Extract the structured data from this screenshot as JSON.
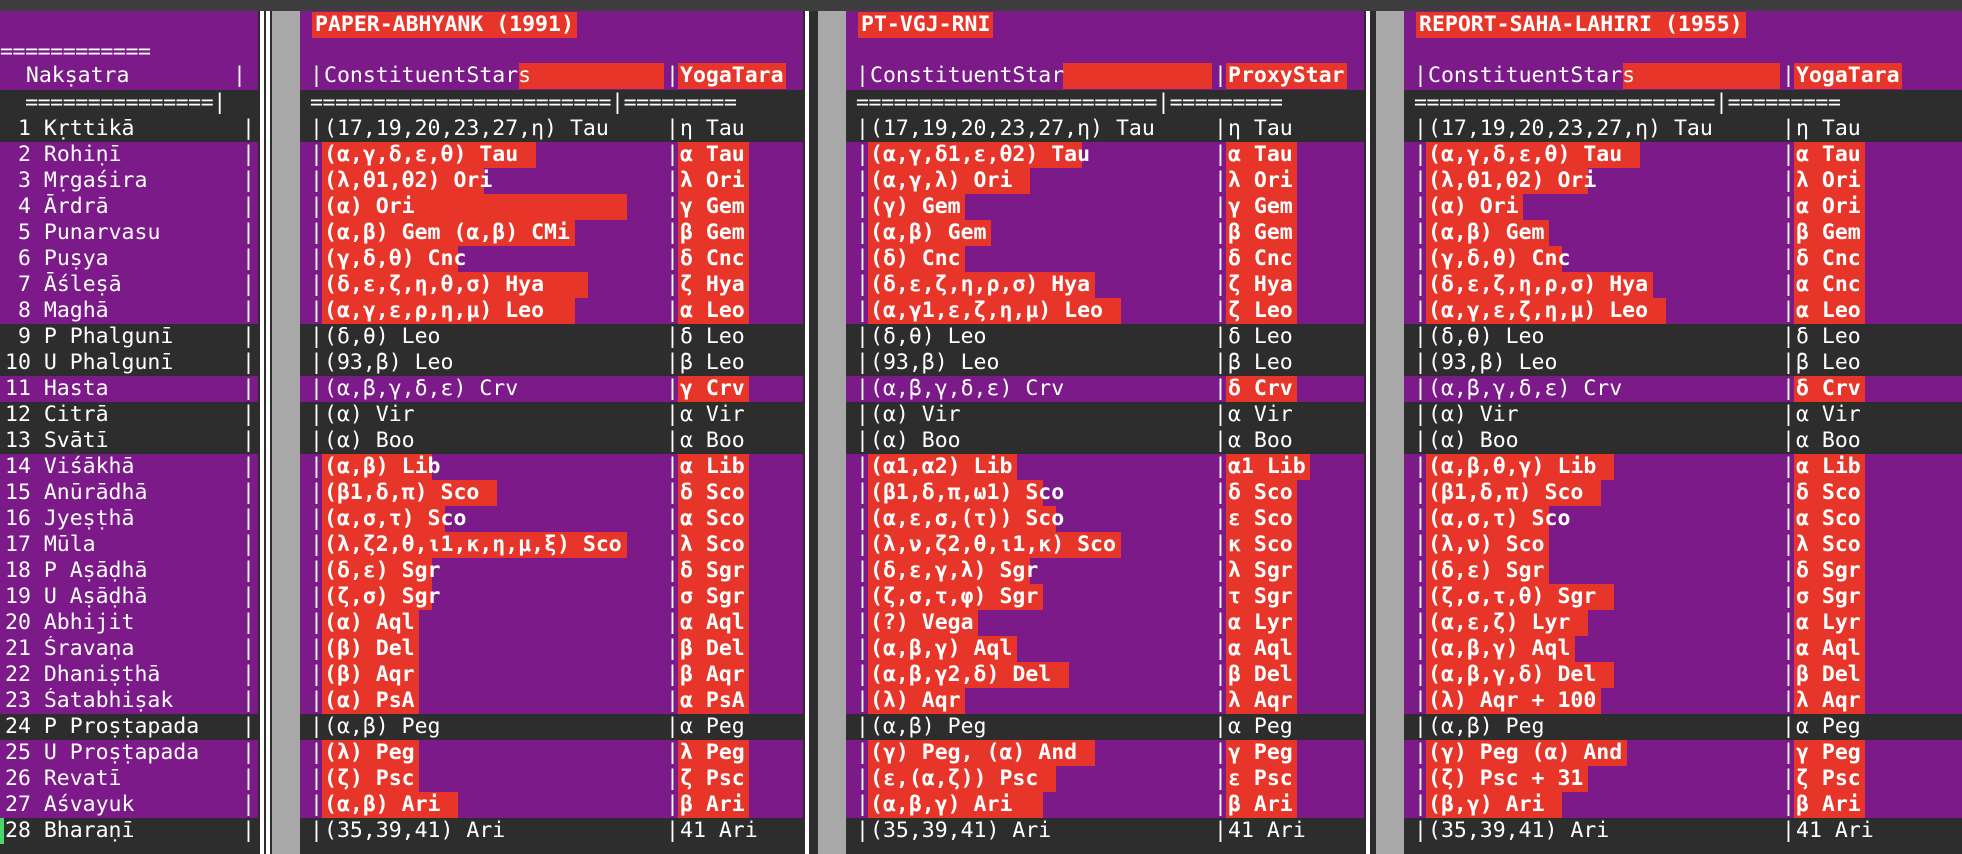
{
  "colors": {
    "purple": "#7b1a88",
    "red": "#e8352a",
    "gray": "#2d2d2d",
    "white": "#ffffff",
    "gutter": "#a8a8a8"
  },
  "index_pane": {
    "equals_top": "============",
    "header": "  Nakṣatra        |",
    "equals_header": "  ===============|",
    "rows": [
      "1 Kṛttikā",
      "2 Rohiṇī",
      "3 Mṛgaśira",
      "4 Ārdrā",
      "5 Punarvasu",
      "6 Puṣya",
      "7 Āśleṣā",
      "8 Maghā",
      "9 P Phalgunī",
      "10 U Phalgunī",
      "11 Hasta",
      "12 Citrā",
      "13 Svātī",
      "14 Viśākhā",
      "15 Anūrādhā",
      "16 Jyeṣṭhā",
      "17 Mūla",
      "18 P Aṣāḍhā",
      "19 U Aṣāḍhā",
      "20 Abhijit",
      "21 Śravaṇa",
      "22 Dhaniṣṭhā",
      "23 Śatabhiṣak",
      "24 P Proṣṭapada",
      "25 U Proṣṭapada",
      "26 Revatī",
      "27 Aśvayuk",
      "28 Bharaṇī"
    ]
  },
  "panes": [
    {
      "title": "PAPER-ABHYANK (1991)",
      "col1_header": "ConstituentStars",
      "col2_header": "YogaTara",
      "equals_header": "========================|=========",
      "rows": [
        [
          "(17,19,20,23,27,η) Tau",
          "η Tau"
        ],
        [
          "(α,γ,δ,ε,θ) Tau",
          "α Tau"
        ],
        [
          "(λ,θ1,θ2) Ori",
          "λ Ori"
        ],
        [
          "(α) Ori",
          "γ Gem"
        ],
        [
          "(α,β) Gem (α,β) CMi",
          "β Gem"
        ],
        [
          "(γ,δ,θ) Cnc",
          "δ Cnc"
        ],
        [
          "(δ,ε,ζ,η,θ,σ) Hya",
          "ζ Hya"
        ],
        [
          "(α,γ,ε,ρ,η,μ) Leo",
          "α Leo"
        ],
        [
          "(δ,θ) Leo",
          "δ Leo"
        ],
        [
          "(93,β) Leo",
          "β Leo"
        ],
        [
          "(α,β,γ,δ,ε) Crv",
          "γ Crv"
        ],
        [
          "(α) Vir",
          "α Vir"
        ],
        [
          "(α) Boo",
          "α Boo"
        ],
        [
          "(α,β) Lib",
          "α Lib"
        ],
        [
          "(β1,δ,π) Sco",
          "δ Sco"
        ],
        [
          "(α,σ,τ) Sco",
          "α Sco"
        ],
        [
          "(λ,ζ2,θ,ι1,κ,η,μ,ξ) Sco",
          "λ Sco"
        ],
        [
          "(δ,ε) Sgr",
          "δ Sgr"
        ],
        [
          "(ζ,σ) Sgr",
          "σ Sgr"
        ],
        [
          "(α) Aql",
          "α Aql"
        ],
        [
          "(β) Del",
          "β Del"
        ],
        [
          "(β) Aqr",
          "β Aqr"
        ],
        [
          "(α) PsA",
          "α PsA"
        ],
        [
          "(α,β) Peg",
          "α Peg"
        ],
        [
          "(λ) Peg",
          "λ Peg"
        ],
        [
          "(ζ) Psc",
          "ζ Psc"
        ],
        [
          "(α,β) Ari",
          "β Ari"
        ],
        [
          "(35,39,41) Ari",
          "41 Ari"
        ]
      ]
    },
    {
      "title": "PT-VGJ-RNI",
      "col1_header": "ConstituentStar",
      "col2_header": "ProxyStar",
      "equals_header": "========================|=========",
      "rows": [
        [
          "(17,19,20,23,27,η) Tau",
          "η Tau"
        ],
        [
          "(α,γ,δ1,ε,θ2) Tau",
          "α Tau"
        ],
        [
          "(α,γ,λ) Ori",
          "λ Ori"
        ],
        [
          "(γ) Gem",
          "γ Gem"
        ],
        [
          "(α,β) Gem",
          "β Gem"
        ],
        [
          "(δ) Cnc",
          "δ Cnc"
        ],
        [
          "(δ,ε,ζ,η,ρ,σ) Hya",
          "ζ Hya"
        ],
        [
          "(α,γ1,ε,ζ,η,μ) Leo",
          "ζ Leo"
        ],
        [
          "(δ,θ) Leo",
          "δ Leo"
        ],
        [
          "(93,β) Leo",
          "β Leo"
        ],
        [
          "(α,β,γ,δ,ε) Crv",
          "δ Crv"
        ],
        [
          "(α) Vir",
          "α Vir"
        ],
        [
          "(α) Boo",
          "α Boo"
        ],
        [
          "(α1,α2) Lib",
          "α1 Lib"
        ],
        [
          "(β1,δ,π,ω1) Sco",
          "δ Sco"
        ],
        [
          "(α,ε,σ,(τ)) Sco",
          "ε Sco"
        ],
        [
          "(λ,ν,ζ2,θ,ι1,κ) Sco",
          "κ Sco"
        ],
        [
          "(δ,ε,γ,λ) Sgr",
          "λ Sgr"
        ],
        [
          "(ζ,σ,τ,φ) Sgr",
          "τ Sgr"
        ],
        [
          "(?) Vega",
          "α Lyr"
        ],
        [
          "(α,β,γ) Aql",
          "α Aql"
        ],
        [
          "(α,β,γ2,δ) Del",
          "β Del"
        ],
        [
          "(λ) Aqr",
          "λ Aqr"
        ],
        [
          "(α,β) Peg",
          "α Peg"
        ],
        [
          "(γ) Peg, (α) And",
          "γ Peg"
        ],
        [
          "(ε,(α,ζ)) Psc",
          "ε Psc"
        ],
        [
          "(α,β,γ) Ari",
          "β Ari"
        ],
        [
          "(35,39,41) Ari",
          "41 Ari"
        ]
      ]
    },
    {
      "title": "REPORT-SAHA-LAHIRI (1955)",
      "col1_header": "ConstituentStars",
      "col2_header": "YogaTara",
      "equals_header": "========================|=========",
      "rows": [
        [
          "(17,19,20,23,27,η) Tau",
          "η Tau"
        ],
        [
          "(α,γ,δ,ε,θ) Tau",
          "α Tau"
        ],
        [
          "(λ,θ1,θ2) Ori",
          "λ Ori"
        ],
        [
          "(α) Ori",
          "α Ori"
        ],
        [
          "(α,β) Gem",
          "β Gem"
        ],
        [
          "(γ,δ,θ) Cnc",
          "δ Cnc"
        ],
        [
          "(δ,ε,ζ,η,ρ,σ) Hya",
          "α Cnc"
        ],
        [
          "(α,γ,ε,ζ,η,μ) Leo",
          "α Leo"
        ],
        [
          "(δ,θ) Leo",
          "δ Leo"
        ],
        [
          "(93,β) Leo",
          "β Leo"
        ],
        [
          "(α,β,γ,δ,ε) Crv",
          "δ Crv"
        ],
        [
          "(α) Vir",
          "α Vir"
        ],
        [
          "(α) Boo",
          "α Boo"
        ],
        [
          "(α,β,θ,γ) Lib",
          "α Lib"
        ],
        [
          "(β1,δ,π) Sco",
          "δ Sco"
        ],
        [
          "(α,σ,τ) Sco",
          "α Sco"
        ],
        [
          "(λ,ν) Sco",
          "λ Sco"
        ],
        [
          "(δ,ε) Sgr",
          "δ Sgr"
        ],
        [
          "(ζ,σ,τ,θ) Sgr",
          "σ Sgr"
        ],
        [
          "(α,ε,ζ) Lyr",
          "α Lyr"
        ],
        [
          "(α,β,γ) Aql",
          "α Aql"
        ],
        [
          "(α,β,γ,δ) Del",
          "β Del"
        ],
        [
          "(λ) Aqr + 100",
          "λ Aqr"
        ],
        [
          "(α,β) Peg",
          "α Peg"
        ],
        [
          "(γ) Peg (α) And",
          "γ Peg"
        ],
        [
          "(ζ) Psc + 31",
          "ζ Psc"
        ],
        [
          "(β,γ) Ari",
          "β Ari"
        ],
        [
          "(35,39,41) Ari",
          "41 Ari"
        ]
      ]
    }
  ]
}
